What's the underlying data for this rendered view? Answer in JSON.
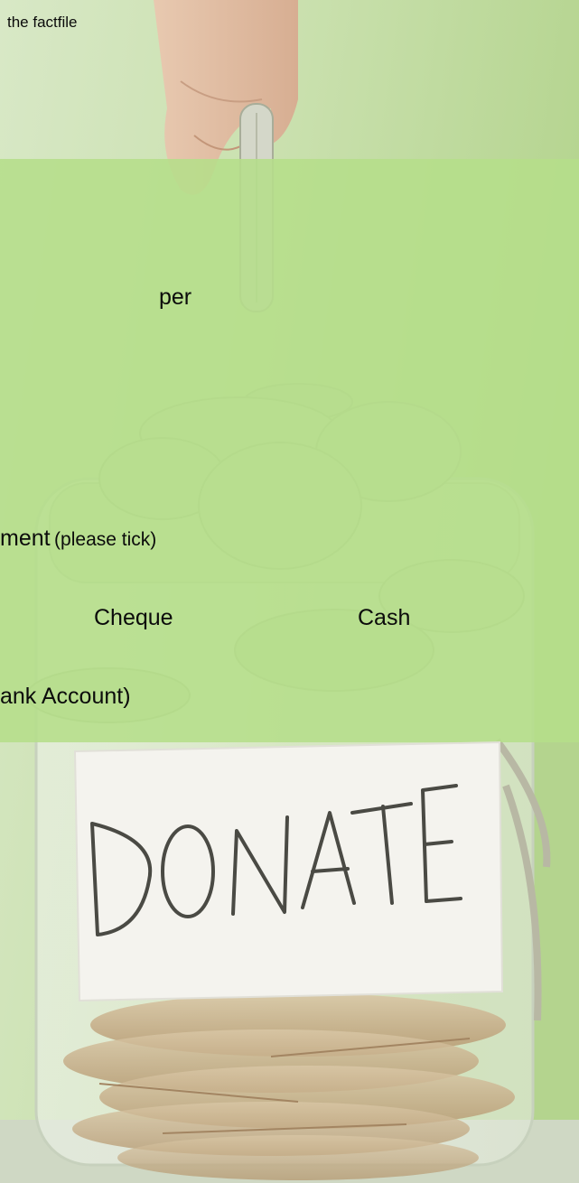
{
  "background": {
    "photo_subject": "hand dropping a coin into a glass jar of coins labelled DONATE",
    "band_color": "#b5de8a",
    "label_color": "#f4f3ee"
  },
  "text": {
    "factfile_fragment": "the factfile",
    "per_label": "per",
    "payment_fragment": "ment",
    "please_tick": "(please tick)",
    "cheque_option": "Cheque",
    "cash_option": "Cash",
    "bank_account_fragment": "ank Account)"
  },
  "jar_label_text": "DONATE"
}
